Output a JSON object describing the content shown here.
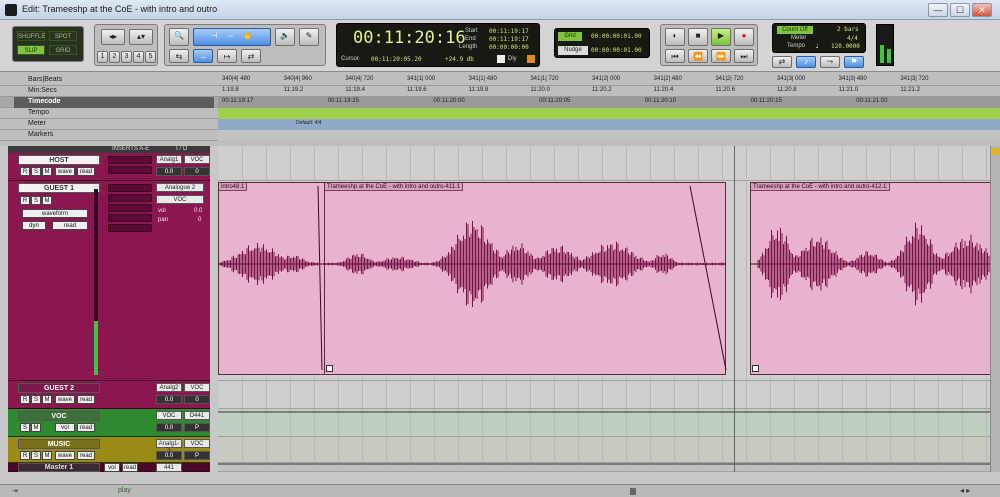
{
  "window": {
    "title": "Edit: Trameeshp at the CoE - with intro and outro",
    "min": "—",
    "max": "☐",
    "close": "✕"
  },
  "toolbar": {
    "modes": [
      "SHUFFLE",
      "SPOT",
      "SLIP",
      "GRID"
    ],
    "zoom_presets": [
      "1",
      "2",
      "3",
      "4",
      "5"
    ],
    "counter": {
      "main": "00:11:20:16",
      "start_label": "Start",
      "end_label": "End",
      "length_label": "Length",
      "start": "00:11:19:17",
      "end": "00:11:19:17",
      "length": "00:00:00:00",
      "cursor_label": "Cursor",
      "cursor": "00:11:20:05.20",
      "db": "+24.9 db",
      "dly": "Dly"
    },
    "grid": {
      "grid_label": "Grid",
      "grid_value": "00:00:00:01.00",
      "nudge_label": "Nudge",
      "nudge_value": "00:00:00:01.00"
    },
    "midi": {
      "count_off": "Count Off",
      "meter_label": "Meter",
      "tempo_label": "Tempo",
      "bars": "2 bars",
      "meter": "4/4",
      "tempo": "120.0000"
    }
  },
  "ruler": {
    "rows": [
      {
        "label": "Bars|Beats",
        "ticks": [
          "340|4| 480",
          "340|4| 960",
          "340|4| 720",
          "341|1| 000",
          "341|1| 480",
          "341|1| 720",
          "341|2| 000",
          "341|2| 480",
          "341|2| 720",
          "341|3| 000",
          "341|3| 480",
          "341|3| 720"
        ]
      },
      {
        "label": "Min:Secs",
        "ticks": [
          "1:19.8",
          "11:19.2",
          "11:19.4",
          "11:19.6",
          "11:19.8",
          "11:20.0",
          "11:20.2",
          "11:20.4",
          "11:20.6",
          "11:20.8",
          "11:21.0",
          "11:21.2"
        ]
      },
      {
        "label": "Timecode",
        "ticks": [
          "00:11:19:17",
          "00:11:19:25",
          "00:11:20:00",
          "00:11:20:05",
          "00:11:20:10",
          "00:11:20:15",
          "00:11:21:00"
        ]
      },
      {
        "label": "Tempo",
        "ticks": []
      },
      {
        "label": "Meter",
        "ticks": [
          "Default: 4/4"
        ]
      },
      {
        "label": "Markers",
        "ticks": []
      }
    ]
  },
  "column_headers": {
    "inserts": "INSERTS A-E",
    "io": "I / O"
  },
  "tracks": [
    {
      "name": "HOST",
      "io_in": "Analg1",
      "io_out": "VOC",
      "vol": "0.0",
      "pan": "0",
      "buttons": [
        "R",
        "S",
        "M"
      ],
      "wave": "wave",
      "read": "read"
    },
    {
      "name": "GUEST 1",
      "io_in": "Analogue 2",
      "io_out": "VOC",
      "vol_label": "vol",
      "vol": "0.0",
      "pan_label": "pan",
      "pan": "0",
      "buttons": [
        "R",
        "S",
        "M"
      ],
      "view": "waveform",
      "dyn": "dyn",
      "read": "read"
    },
    {
      "name": "GUEST 2",
      "io_in": "Analg2",
      "io_out": "VOC",
      "vol": "0.0",
      "pan": "0",
      "buttons": [
        "R",
        "S",
        "M"
      ],
      "wave": "wave",
      "read": "read"
    },
    {
      "name": "VOC",
      "io_in": "VOC",
      "io_out": "D441",
      "vol": "0.0",
      "pan": "P",
      "buttons": [
        "S",
        "M"
      ],
      "wave": "vol",
      "read": "read"
    },
    {
      "name": "MUSIC",
      "io_in": "Analg1-2",
      "io_out": "VOC",
      "vol": "0.0",
      "pan": "P",
      "buttons": [
        "R",
        "S",
        "M"
      ],
      "wave": "wave",
      "read": "read"
    },
    {
      "name": "Master 1",
      "io_out": "441",
      "buttons": [
        "vol",
        "read"
      ]
    }
  ],
  "clips": [
    {
      "name": "intro48.1"
    },
    {
      "name": "Trameeshp at the CoE - with intro and outro-411.1"
    },
    {
      "name": "Trameeshp at the CoE - with intro and outro-412.1"
    }
  ],
  "status": {
    "play_label": "play"
  },
  "colors": {
    "track_maroon": "#8a1750",
    "clip_pink": "#e8b4cd",
    "waveform": "#7a1247",
    "voc_green": "#2f8a2f",
    "music_yellow": "#9a8a16",
    "lcd_green": "#d7e56b"
  }
}
